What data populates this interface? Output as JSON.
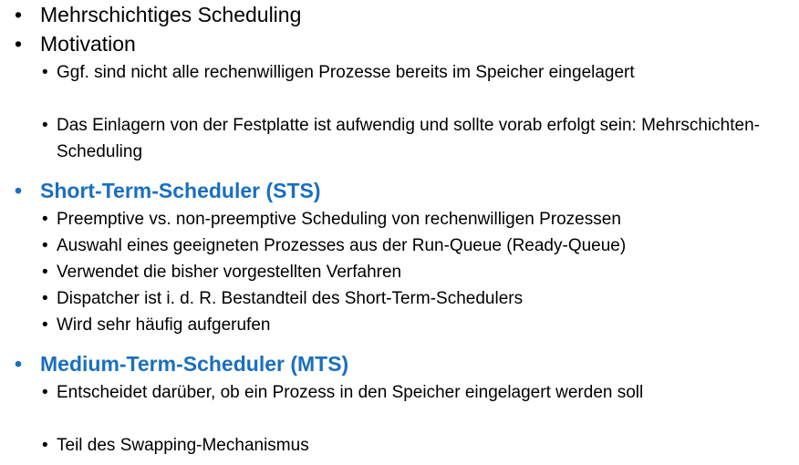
{
  "items": [
    {
      "bullet": "•",
      "text": "Mehrschichtiges Scheduling"
    },
    {
      "bullet": "•",
      "text": "Motivation"
    },
    {
      "bullet": "•",
      "text": "Ggf. sind nicht alle rechenwilligen Prozesse bereits im Speicher eingelagert"
    },
    {
      "bullet": "•",
      "text": "Das Einlagern von der Festplatte ist aufwendig und sollte vorab erfolgt sein: Mehrschichten-Scheduling"
    },
    {
      "bullet": "•",
      "text": "Short-Term-Scheduler (STS)"
    },
    {
      "bullet": "•",
      "text": "Preemptive vs. non-preemptive Scheduling von rechenwilligen Prozessen"
    },
    {
      "bullet": "•",
      "text": "Auswahl eines geeigneten Prozesses aus der Run-Queue (Ready-Queue)"
    },
    {
      "bullet": "•",
      "text": "Verwendet die bisher vorgestellten Verfahren"
    },
    {
      "bullet": "•",
      "text": "Dispatcher ist i. d. R. Bestandteil des Short-Term-Schedulers"
    },
    {
      "bullet": "•",
      "text": "Wird sehr häufig aufgerufen"
    },
    {
      "bullet": "•",
      "text": "Medium-Term-Scheduler (MTS)"
    },
    {
      "bullet": "•",
      "text": "Entscheidet darüber, ob ein Prozess in den Speicher eingelagert werden soll"
    },
    {
      "bullet": "•",
      "text": "Teil des Swapping-Mechanismus"
    }
  ],
  "colors": {
    "heading_blue": "#1a6fbf",
    "text": "#000000",
    "background": "#ffffff"
  }
}
